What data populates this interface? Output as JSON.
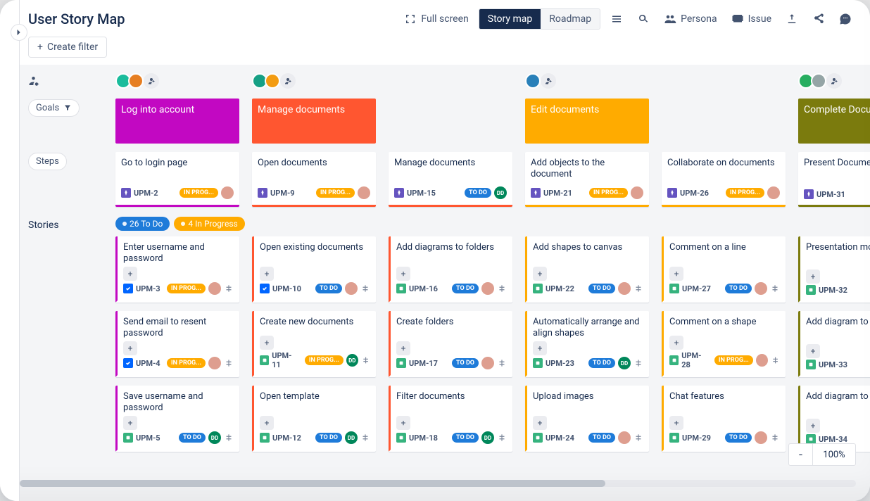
{
  "header": {
    "title": "User Story Map",
    "full_screen": "Full screen",
    "tab_story_map": "Story map",
    "tab_roadmap": "Roadmap",
    "persona": "Persona",
    "issue": "Issue",
    "create_filter": "Create filter"
  },
  "row_labels": {
    "goals": "Goals",
    "steps": "Steps",
    "stories": "Stories"
  },
  "status_labels": {
    "todo": "TO DO",
    "inprog": "IN PROG..."
  },
  "counts": {
    "todo": "26 To Do",
    "inprog": "4 In Progress"
  },
  "zoom": {
    "minus": "-",
    "value": "100%"
  },
  "columns": [
    {
      "accent": "magenta",
      "goal": "Log into account",
      "step": {
        "title": "Go to login page",
        "key": "UPM-2",
        "status": "inprog",
        "assignee": "img"
      },
      "stories": [
        {
          "title": "Enter username and password",
          "key": "UPM-3",
          "type": "subtask",
          "status": "inprog",
          "assignee": "img"
        },
        {
          "title": "Send email to resent password",
          "key": "UPM-4",
          "type": "subtask",
          "status": "inprog",
          "assignee": "img"
        },
        {
          "title": "Save username and password",
          "key": "UPM-5",
          "type": "story",
          "status": "todo",
          "assignee": "dd"
        }
      ]
    },
    {
      "accent": "orange",
      "goal": "Manage documents",
      "step": {
        "title": "Open documents",
        "key": "UPM-9",
        "status": "inprog",
        "assignee": "img"
      },
      "stories": [
        {
          "title": "Open existing documents",
          "key": "UPM-10",
          "type": "subtask",
          "status": "todo",
          "assignee": "img"
        },
        {
          "title": "Create new documents",
          "key": "UPM-11",
          "type": "story",
          "status": "inprog",
          "assignee": "dd"
        },
        {
          "title": "Open template",
          "key": "UPM-12",
          "type": "story",
          "status": "todo",
          "assignee": "dd"
        }
      ]
    },
    {
      "accent": "orange",
      "step": {
        "title": "Manage documents",
        "key": "UPM-15",
        "status": "todo",
        "assignee": "dd"
      },
      "stories": [
        {
          "title": "Add diagrams to folders",
          "key": "UPM-16",
          "type": "story",
          "status": "todo",
          "assignee": "img"
        },
        {
          "title": "Create folders",
          "key": "UPM-17",
          "type": "story",
          "status": "todo",
          "assignee": "img"
        },
        {
          "title": "Filter documents",
          "key": "UPM-18",
          "type": "story",
          "status": "todo",
          "assignee": "dd"
        }
      ]
    },
    {
      "accent": "amber",
      "goal": "Edit documents",
      "step": {
        "title": "Add objects to the document",
        "key": "UPM-21",
        "status": "inprog",
        "assignee": "img"
      },
      "stories": [
        {
          "title": "Add shapes to canvas",
          "key": "UPM-22",
          "type": "story",
          "status": "todo",
          "assignee": "img"
        },
        {
          "title": "Automatically arrange and align shapes",
          "key": "UPM-23",
          "type": "story",
          "status": "todo",
          "assignee": "dd"
        },
        {
          "title": "Upload images",
          "key": "UPM-24",
          "type": "story",
          "status": "todo",
          "assignee": "img"
        }
      ]
    },
    {
      "accent": "amber",
      "step": {
        "title": "Collaborate on documents",
        "key": "UPM-26",
        "status": "inprog",
        "assignee": "img"
      },
      "stories": [
        {
          "title": "Comment on a line",
          "key": "UPM-27",
          "type": "story",
          "status": "todo",
          "assignee": "img"
        },
        {
          "title": "Comment on a shape",
          "key": "UPM-28",
          "type": "story",
          "status": "inprog",
          "assignee": "img"
        },
        {
          "title": "Chat features",
          "key": "UPM-29",
          "type": "story",
          "status": "todo",
          "assignee": "img"
        }
      ]
    },
    {
      "accent": "olive",
      "goal": "Complete Documents",
      "step": {
        "title": "Present Document",
        "key": "UPM-31",
        "status": "todo",
        "assignee": ""
      },
      "stories": [
        {
          "title": "Presentation mode",
          "key": "UPM-32",
          "type": "story",
          "status": "todo",
          "assignee": ""
        },
        {
          "title": "Add diagram to Google",
          "key": "UPM-33",
          "type": "story",
          "status": "todo",
          "assignee": ""
        },
        {
          "title": "Add diagram to Conflu",
          "key": "UPM-34",
          "type": "story",
          "status": "todo",
          "assignee": ""
        }
      ]
    }
  ],
  "colors": {
    "magenta": "#c208c2",
    "orange": "#ff5630",
    "amber": "#ffab00",
    "olive": "#7b7b0d"
  }
}
